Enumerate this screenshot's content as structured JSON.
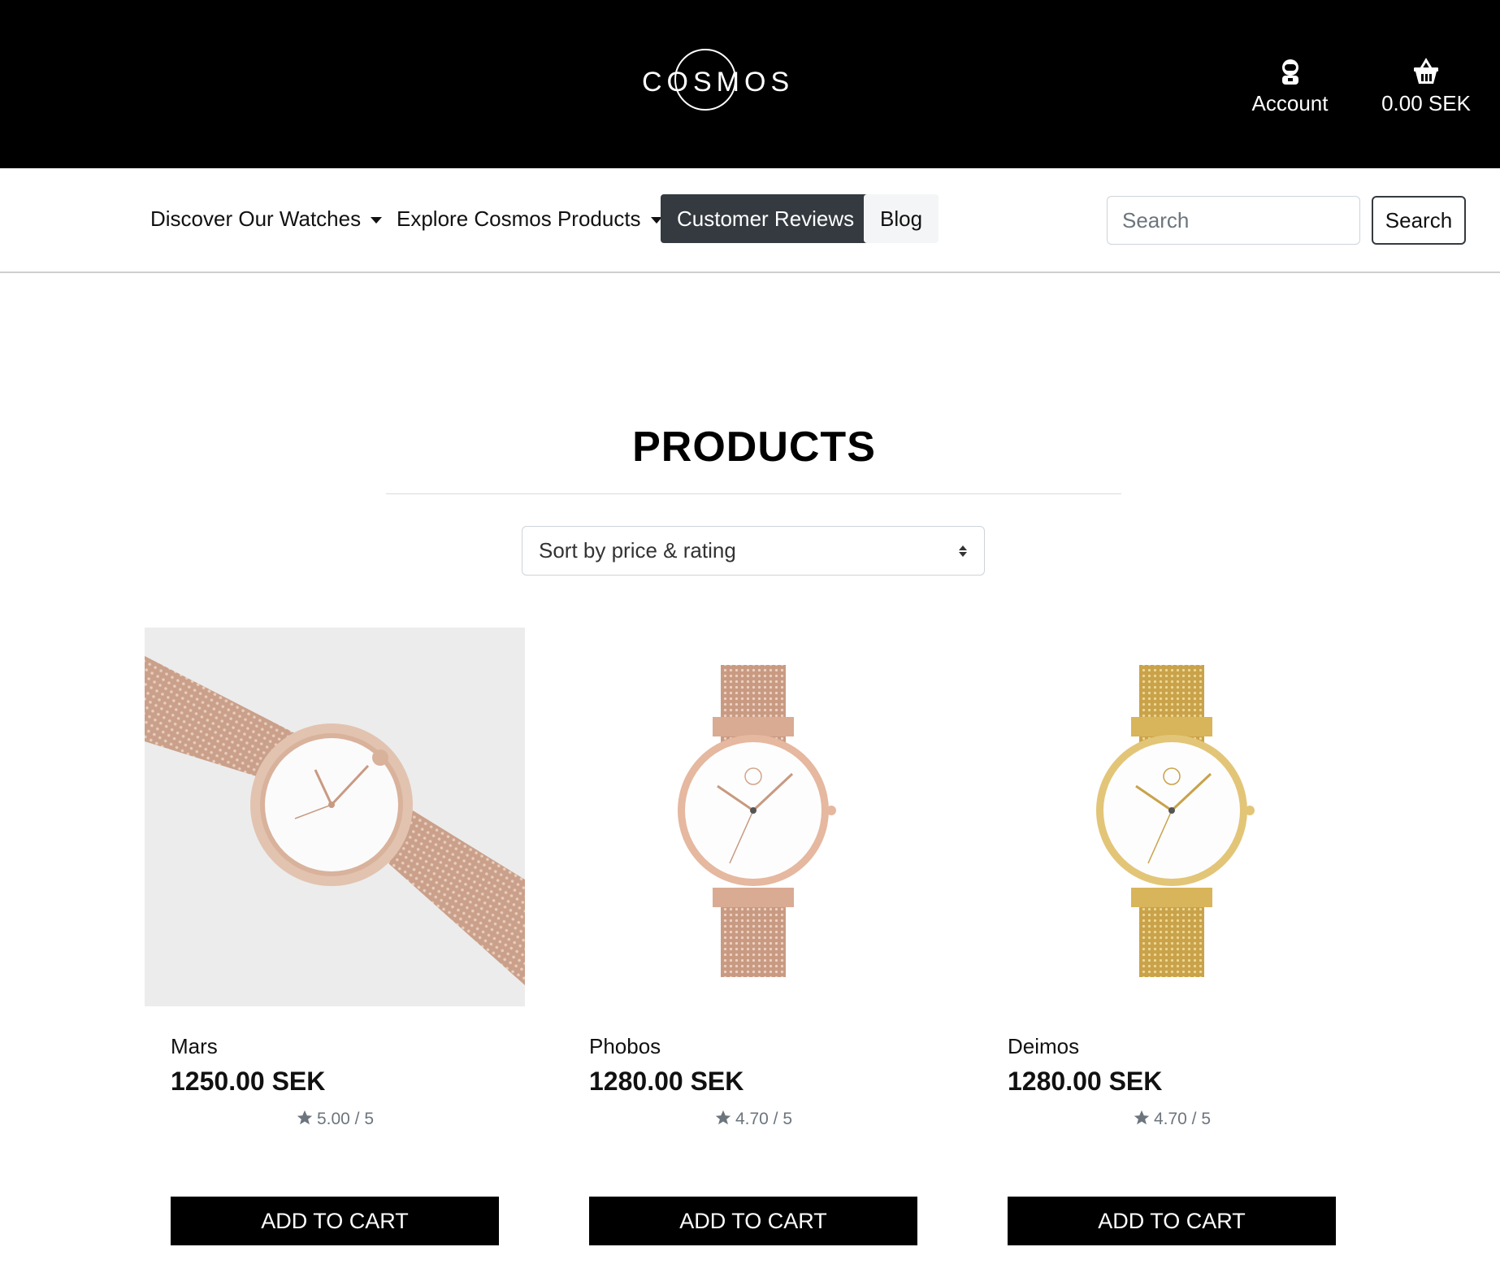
{
  "brand": {
    "name": "COSMOS"
  },
  "header": {
    "account_label": "Account",
    "cart_total": "0.00 SEK"
  },
  "nav": {
    "items": [
      {
        "label": "Discover Our Watches",
        "dropdown": true
      },
      {
        "label": "Explore Cosmos Products",
        "dropdown": true
      },
      {
        "label": "Customer Reviews",
        "active": true
      },
      {
        "label": "Blog"
      }
    ],
    "search": {
      "placeholder": "Search",
      "button_label": "Search"
    }
  },
  "main": {
    "title": "PRODUCTS",
    "sort": {
      "selected": "Sort by price & rating"
    },
    "products": [
      {
        "name": "Mars",
        "price": "1250.00 SEK",
        "rating": "5.00 / 5",
        "button_label": "ADD TO CART",
        "image": "rose-gold-mesh-watch-lifestyle"
      },
      {
        "name": "Phobos",
        "price": "1280.00 SEK",
        "rating": "4.70 / 5",
        "button_label": "ADD TO CART",
        "image": "rose-gold-mesh-watch-front"
      },
      {
        "name": "Deimos",
        "price": "1280.00 SEK",
        "rating": "4.70 / 5",
        "button_label": "ADD TO CART",
        "image": "gold-mesh-watch-front"
      }
    ]
  },
  "colors": {
    "header_bg": "#000000",
    "active_nav_bg": "#343a40",
    "button_bg": "#000000",
    "rose_gold": "#d9a98f",
    "gold": "#d8b45a"
  }
}
